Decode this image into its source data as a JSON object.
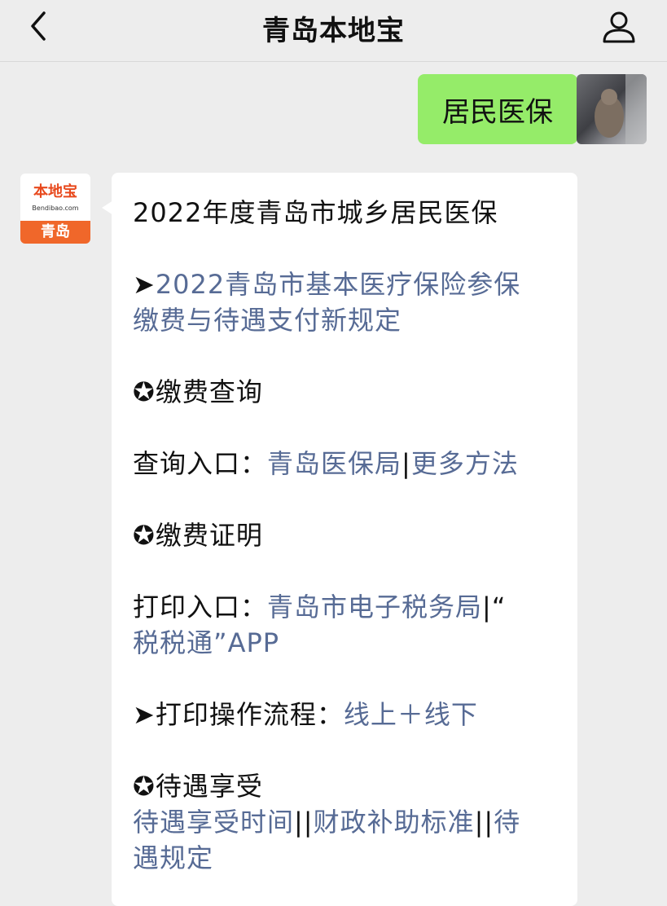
{
  "header": {
    "title": "青岛本地宝",
    "back_icon": "chevron-left-icon",
    "profile_icon": "person-icon"
  },
  "user_message": {
    "text": "居民医保",
    "bubble_color": "#95ec69"
  },
  "bot_avatar": {
    "brand": "本地宝",
    "site": "Bendibao.com",
    "city": "青岛",
    "accent": "#f0672a"
  },
  "bot_message": {
    "heading": "2022年度青岛市城乡居民医保",
    "arrow1": "➤",
    "link_policy_1": "2022青岛市基本医疗保险参保",
    "link_policy_2": "缴费与待遇支付新规定",
    "section_query": "✪缴费查询",
    "query_label": "查询入口：",
    "query_link1": "青岛医保局",
    "sep1": "|",
    "query_link2": "更多方法",
    "section_proof": "✪缴费证明",
    "print_label": "打印入口：",
    "print_link1": "青岛市电子税务局",
    "sep2": "|“",
    "print_link2": "税税通”APP",
    "arrow2": "➤",
    "flow_label": "打印操作流程：",
    "flow_link": "线上＋线下",
    "section_benefit": "✪待遇享受",
    "benefit_link1": "待遇享受时间",
    "sep3": "||",
    "benefit_link2": "财政补助标准",
    "sep4": "||",
    "benefit_link3a": "待",
    "benefit_link3b": "遇规定",
    "link_color": "#576b95"
  }
}
